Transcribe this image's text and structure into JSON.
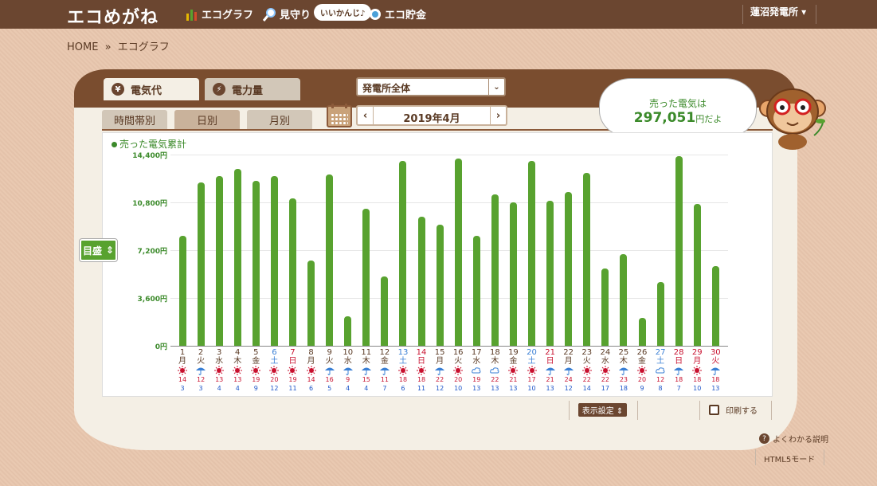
{
  "header": {
    "logo": "エコめがね",
    "nav": [
      {
        "label": "エコグラフ",
        "icon": "bar-chart-icon"
      },
      {
        "label": "見守り",
        "icon": "magnifier-icon"
      },
      {
        "label": "エコ貯金",
        "icon": "coin-icon"
      }
    ],
    "bubble": "いいかんじ♪",
    "plant": "蓮沼発電所 ▾"
  },
  "breadcrumb": {
    "home": "HOME",
    "sep": "»",
    "current": "エコグラフ"
  },
  "tabs": {
    "main": [
      {
        "label": "電気代",
        "icon": "yen-icon",
        "symbol": "¥",
        "active": true
      },
      {
        "label": "電力量",
        "icon": "lightning-icon",
        "symbol": "⚡",
        "active": false
      }
    ],
    "sub": [
      {
        "label": "時間帯別",
        "active": false
      },
      {
        "label": "日別",
        "active": true
      },
      {
        "label": "月別",
        "active": false
      }
    ]
  },
  "plant_select": {
    "value": "発電所全体"
  },
  "date_nav": {
    "label": "2019年4月",
    "prev": "‹",
    "next": "›"
  },
  "summary": {
    "line1": "売った電気は",
    "amount": "297,051",
    "suffix": "円だよ"
  },
  "legend": "売った電気累計",
  "meyasu": "目盛",
  "controls": {
    "display_settings": "表示設定 ⇕",
    "print": "印刷する",
    "help": "よくわかる説明",
    "html5": "HTML5モード"
  },
  "colors": {
    "bar": "#58a22f",
    "brown": "#6b4630",
    "saturday": "#3a7fd5",
    "holiday": "#c8102e"
  },
  "chart_data": {
    "type": "bar",
    "ylabel": "",
    "ylim": [
      0,
      14400
    ],
    "yticks": [
      "14,400円",
      "10,800円",
      "7,200円",
      "3,600円",
      "0円"
    ],
    "yvals": [
      14400,
      10800,
      7200,
      3600,
      0
    ],
    "categories": [
      "1",
      "2",
      "3",
      "4",
      "5",
      "6",
      "7",
      "8",
      "9",
      "10",
      "11",
      "12",
      "13",
      "14",
      "15",
      "16",
      "17",
      "18",
      "19",
      "20",
      "21",
      "22",
      "23",
      "24",
      "25",
      "26",
      "27",
      "28",
      "29",
      "30"
    ],
    "weekdays": [
      "月",
      "火",
      "水",
      "木",
      "金",
      "土",
      "日",
      "月",
      "火",
      "水",
      "木",
      "金",
      "土",
      "日",
      "月",
      "火",
      "水",
      "木",
      "金",
      "土",
      "日",
      "月",
      "火",
      "水",
      "木",
      "金",
      "土",
      "日",
      "月",
      "火"
    ],
    "day_colors": [
      "n",
      "n",
      "n",
      "n",
      "n",
      "s",
      "h",
      "n",
      "n",
      "n",
      "n",
      "n",
      "s",
      "h",
      "n",
      "n",
      "n",
      "n",
      "n",
      "s",
      "h",
      "n",
      "n",
      "n",
      "n",
      "n",
      "s",
      "h",
      "h",
      "h"
    ],
    "values": [
      8300,
      12300,
      12800,
      13300,
      12400,
      12800,
      11100,
      6400,
      12900,
      2200,
      10300,
      5200,
      13900,
      9700,
      9100,
      14100,
      8300,
      11400,
      10800,
      13900,
      10900,
      11600,
      13000,
      5800,
      6900,
      2100,
      4800,
      14300,
      10700,
      6000
    ],
    "weather": [
      "sun-umbrella",
      "umbrella-sun",
      "sun",
      "sun",
      "sun",
      "sun",
      "sun",
      "sun",
      "umbrella",
      "umbrella",
      "umbrella",
      "umbrella",
      "sun",
      "sun-umbrella",
      "umbrella-sun",
      "sun",
      "cloud",
      "cloud-sun",
      "sun",
      "sun",
      "umbrella-sun",
      "umbrella",
      "sun",
      "sun-cloud",
      "umbrella",
      "sun",
      "cloud",
      "umbrella",
      "sun",
      "umbrella"
    ],
    "temp_high": [
      "14",
      "12",
      "13",
      "13",
      "19",
      "20",
      "19",
      "14",
      "16",
      "9",
      "15",
      "11",
      "18",
      "18",
      "22",
      "20",
      "19",
      "22",
      "21",
      "17",
      "21",
      "24",
      "22",
      "22",
      "23",
      "20",
      "12",
      "18",
      "18",
      "18"
    ],
    "temp_low": [
      "3",
      "3",
      "4",
      "4",
      "9",
      "12",
      "11",
      "6",
      "5",
      "4",
      "4",
      "7",
      "6",
      "11",
      "12",
      "10",
      "13",
      "13",
      "13",
      "10",
      "13",
      "12",
      "14",
      "17",
      "18",
      "9",
      "8",
      "7",
      "10",
      "13"
    ]
  }
}
